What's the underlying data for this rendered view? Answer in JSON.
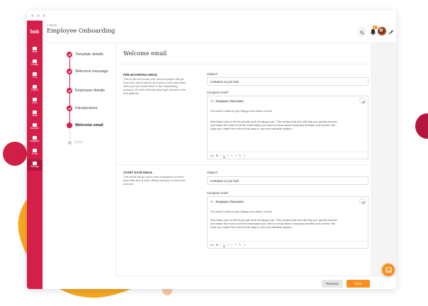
{
  "header": {
    "back": "< Back",
    "title": "Employee Onboarding",
    "notifications": "13"
  },
  "logo": "bob",
  "nav": [
    {
      "label": "Home"
    },
    {
      "label": "People"
    },
    {
      "label": "Time"
    },
    {
      "label": "Payroll"
    },
    {
      "label": "Docs"
    },
    {
      "label": "Tasks"
    },
    {
      "label": "Benefits"
    },
    {
      "label": "Analytics"
    },
    {
      "label": "Comp"
    },
    {
      "label": "Settings"
    }
  ],
  "steps": [
    {
      "label": "Template details",
      "state": "done"
    },
    {
      "label": "Welcome message",
      "state": "done"
    },
    {
      "label": "Employee details",
      "state": "done"
    },
    {
      "label": "Introductions",
      "state": "done"
    },
    {
      "label": "Welcome email",
      "state": "current"
    },
    {
      "label": "Docs",
      "state": "todo"
    }
  ],
  "card": {
    "title": "Welcome email"
  },
  "preboarding": {
    "title": "PRE-BOARDING EMAIL",
    "desc": "This is the first email your new employee will get from bob, and it will be sent before their start date. Here you can invite them to the onboarding process. On their first day they'll get access to the bob platform.",
    "subject_label": "Subject",
    "subject_value": "Invitation to join bob",
    "compose_label": "Compose email",
    "hi": "Hi",
    "chip": "Employee - First name",
    "p1": "You were invited to join Happy.core demo on bob.",
    "p2a": "Bob takes care of all the people stuff at Happy.core. This means that bob will help you quickly access",
    "p2b": "and make the most of all the information you need to know about company benefits and events. We",
    "p2c": "hope you make the most of this easy to use and valuable system."
  },
  "startdate": {
    "title": "START DATE EMAIL",
    "desc": "This email will go out to new employees on their start date and is their official welcome to their bob account.",
    "subject_label": "Subject",
    "subject_value": "Invitation to join bob",
    "compose_label": "Compose email",
    "hi": "Hi",
    "chip": "Employee - First name",
    "p1": "You were invited to join Happy.core demo on bob.",
    "p2a": "Bob takes care of all the people stuff at Happy.core. This means that bob will help you quickly access",
    "p2b": "and make the most of all the information you need to know about company benefits and events. We",
    "p2c": "hope you make the most of this easy to use and valuable system."
  },
  "toolbar": [
    "Aa",
    "B",
    "I",
    "U",
    "≡",
    "≡",
    "≡",
    "✎",
    "☺"
  ],
  "footer": {
    "previous": "Previous",
    "next": "Next"
  },
  "colors": {
    "brand": "#d51f4a",
    "accent": "#f7901e"
  }
}
